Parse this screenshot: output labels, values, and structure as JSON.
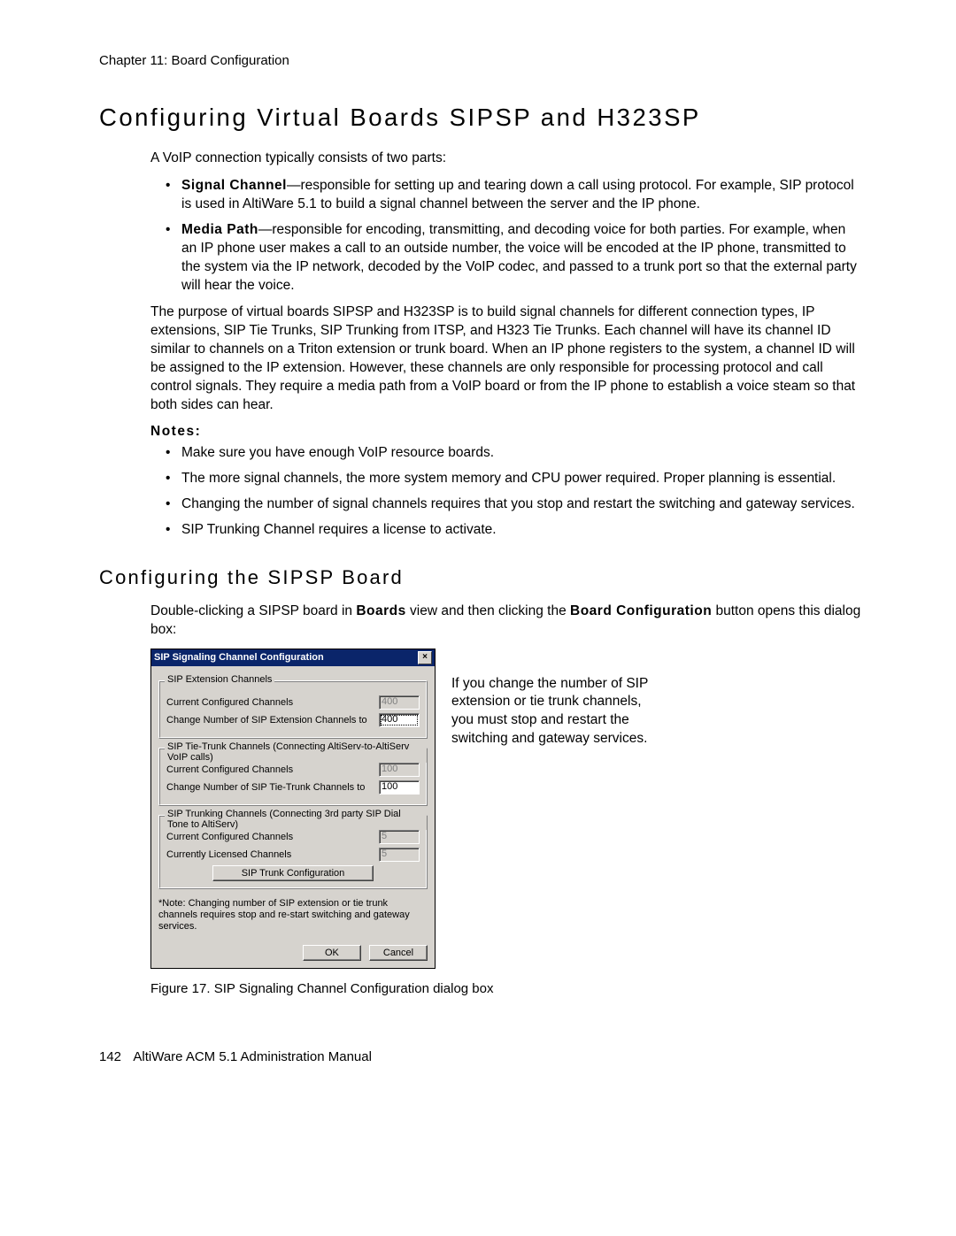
{
  "header": {
    "chapter": "Chapter 11:  Board Configuration"
  },
  "h1": "Configuring Virtual Boards SIPSP and H323SP",
  "intro": "A VoIP connection typically consists of two parts:",
  "parts": [
    {
      "term": "Signal Channel",
      "text": "—responsible for setting up and tearing down a call using protocol. For example, SIP protocol is used in AltiWare 5.1 to build a signal channel between the server and the IP phone."
    },
    {
      "term": "Media Path",
      "text": "—responsible for encoding, transmitting, and decoding voice for both parties. For example, when an IP phone user makes a call to an outside number, the voice will be encoded at the IP phone, transmitted to the system via the IP network, decoded by the VoIP codec, and passed to a trunk port so that the external party will hear the voice."
    }
  ],
  "purpose": "The purpose of virtual boards SIPSP and H323SP is to build signal channels for different connection types, IP extensions, SIP Tie Trunks, SIP Trunking from ITSP, and H323 Tie Trunks. Each channel will have its channel ID similar to channels on a Triton extension or trunk board. When an IP phone registers to the system, a channel ID will be assigned to the IP extension. However, these channels are only responsible for processing protocol and call control signals. They require a media path from a VoIP board or from the IP phone to establish a voice steam so that both sides can hear.",
  "notes_label": "Notes:",
  "notes": [
    "Make sure you have enough VoIP resource boards.",
    "The more signal channels, the more system memory and CPU power required. Proper planning is essential.",
    "Changing the number of signal channels requires that you stop and restart the switching and gateway services.",
    "SIP Trunking Channel requires a license to activate."
  ],
  "h2": "Configuring the SIPSP Board",
  "config_intro_pre": "Double-clicking a SIPSP board in ",
  "config_intro_b1": "Boards",
  "config_intro_mid": " view and then clicking the ",
  "config_intro_b2": "Board Configuration",
  "config_intro_post": " button opens this dialog box:",
  "side_note": "If you change the number of SIP extension or tie trunk channels, you must stop and restart the switching and gateway services.",
  "dialog": {
    "title": "SIP Signaling Channel Configuration",
    "close_glyph": "×",
    "group1": {
      "legend": "SIP Extension Channels",
      "row1_label": "Current Configured Channels",
      "row1_value": "400",
      "row2_label": "Change Number of SIP Extension Channels to",
      "row2_value": "400"
    },
    "group2": {
      "legend": "SIP Tie-Trunk Channels (Connecting AltiServ-to-AltiServ VoIP calls)",
      "row1_label": "Current Configured Channels",
      "row1_value": "100",
      "row2_label": "Change Number of SIP Tie-Trunk Channels to",
      "row2_value": "100"
    },
    "group3": {
      "legend": "SIP Trunking Channels (Connecting 3rd party SIP Dial Tone to AltiServ)",
      "row1_label": "Current Configured Channels",
      "row1_value": "5",
      "row2_label": "Currently Licensed Channels",
      "row2_value": "5",
      "button": "SIP Trunk Configuration"
    },
    "note": "*Note: Changing number of SIP extension or tie trunk channels requires stop and re-start switching and gateway services.",
    "ok": "OK",
    "cancel": "Cancel"
  },
  "figure_caption": "Figure 17.    SIP Signaling Channel Configuration dialog box",
  "footer": {
    "page": "142",
    "book": "AltiWare ACM 5.1 Administration Manual"
  }
}
